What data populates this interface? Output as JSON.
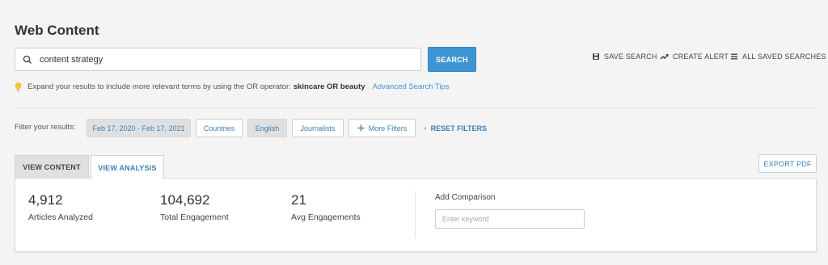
{
  "header": {
    "title": "Web Content"
  },
  "search": {
    "value": "content strategy",
    "button_label": "SEARCH"
  },
  "actions": {
    "save_search": "SAVE SEARCH",
    "create_alert": "CREATE ALERT",
    "all_saved": "ALL SAVED SEARCHES"
  },
  "tip": {
    "text": "Expand your results to include more relevant terms by using the OR operator:",
    "example": "skincare OR beauty",
    "link": "Advanced Search Tips"
  },
  "filters": {
    "label": "Filter your results:",
    "date_range": "Feb 17, 2020 - Feb 17, 2021",
    "countries": "Countries",
    "language": "English",
    "journalists": "Journalists",
    "more_filters": "More Filters",
    "reset": "RESET FILTERS"
  },
  "tabs": [
    {
      "label": "VIEW CONTENT",
      "active": false
    },
    {
      "label": "VIEW ANALYSIS",
      "active": true
    }
  ],
  "export_label": "EXPORT PDF",
  "stats": [
    {
      "value": "4,912",
      "label": "Articles Analyzed"
    },
    {
      "value": "104,692",
      "label": "Total Engagement"
    },
    {
      "value": "21",
      "label": "Avg Engagements"
    }
  ],
  "comparison": {
    "label": "Add Comparison",
    "placeholder": "Enter keyword"
  },
  "colors": {
    "accent": "#3d96d3",
    "link": "#3d7fb8",
    "tip_bulb": "#f5c242",
    "background": "#f4f4f4"
  },
  "icons": [
    "search-icon",
    "save-icon",
    "trend-up-icon",
    "list-icon",
    "lightbulb-icon",
    "plus-icon",
    "refresh-icon"
  ]
}
